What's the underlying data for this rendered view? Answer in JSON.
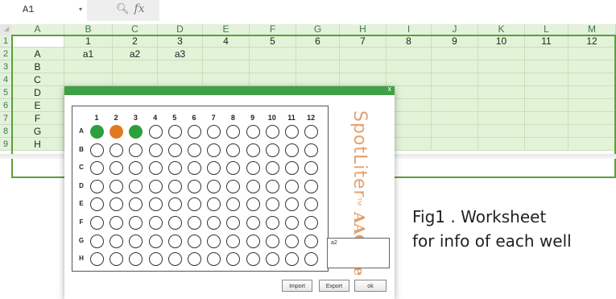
{
  "spreadsheet": {
    "name_box": "A1",
    "fx_label": "fx",
    "columns": [
      "A",
      "B",
      "C",
      "D",
      "E",
      "F",
      "G",
      "H",
      "I",
      "J",
      "K",
      "L",
      "M"
    ],
    "rows": [
      "1",
      "2",
      "3",
      "4",
      "5",
      "6",
      "7",
      "8",
      "9"
    ],
    "cells": [
      [
        "",
        "1",
        "2",
        "3",
        "4",
        "5",
        "6",
        "7",
        "8",
        "9",
        "10",
        "11",
        "12"
      ],
      [
        "A",
        "a1",
        "a2",
        "a3",
        "",
        "",
        "",
        "",
        "",
        "",
        "",
        "",
        ""
      ],
      [
        "B",
        "",
        "",
        "",
        "",
        "",
        "",
        "",
        "",
        "",
        "",
        "",
        ""
      ],
      [
        "C",
        "",
        "",
        "",
        "",
        "",
        "",
        "",
        "",
        "",
        "",
        "",
        ""
      ],
      [
        "D",
        "",
        "",
        "",
        "",
        "",
        "",
        "",
        "",
        "",
        "",
        "",
        ""
      ],
      [
        "E",
        "",
        "",
        "",
        "",
        "",
        "",
        "",
        "",
        "",
        "",
        "",
        ""
      ],
      [
        "F",
        "",
        "",
        "",
        "",
        "",
        "",
        "",
        "",
        "",
        "",
        "",
        ""
      ],
      [
        "G",
        "",
        "",
        "",
        "",
        "",
        "",
        "",
        "",
        "",
        "",
        "",
        ""
      ],
      [
        "H",
        "",
        "",
        "",
        "",
        "",
        "",
        "",
        "",
        "",
        "",
        "",
        ""
      ]
    ]
  },
  "dialog": {
    "close_label": "x",
    "plate": {
      "column_labels": [
        "1",
        "2",
        "3",
        "4",
        "5",
        "6",
        "7",
        "8",
        "9",
        "10",
        "11",
        "12"
      ],
      "row_labels": [
        "A",
        "B",
        "C",
        "D",
        "E",
        "F",
        "G",
        "H"
      ],
      "filled_wells": [
        {
          "row": "A",
          "col": 1,
          "color": "#2e9e3e"
        },
        {
          "row": "A",
          "col": 2,
          "color": "#e07a22"
        },
        {
          "row": "A",
          "col": 3,
          "color": "#2e9e3e"
        }
      ]
    },
    "brand_name": "SpotLiter",
    "brand_tm": "TM",
    "brand_logo": "AAGene",
    "info_text": "a2",
    "buttons": {
      "import": "Import",
      "export": "Export",
      "ok": "ok"
    }
  },
  "caption": {
    "line1": "Fig1 . Worksheet",
    "line2": "for info of each well"
  },
  "colors": {
    "grid_green": "#e3f3d8",
    "header_green": "#e4f1dd",
    "selection_border": "#5aa03c",
    "titlebar": "#3fa046",
    "brand": "#e3a271"
  }
}
